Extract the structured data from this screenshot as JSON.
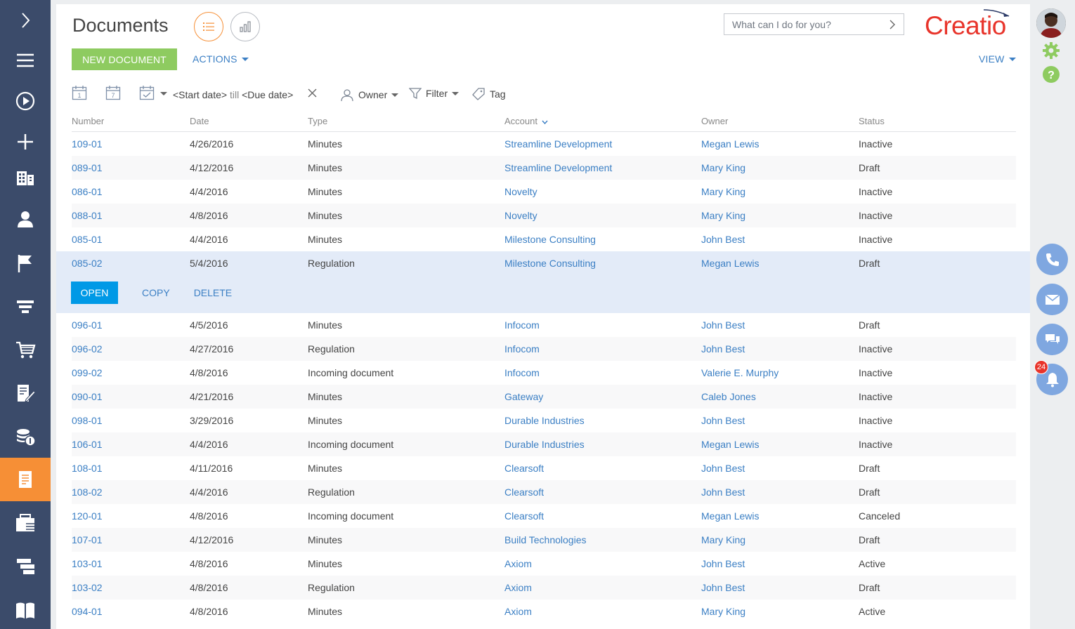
{
  "page": {
    "title": "Documents",
    "new_button": "NEW DOCUMENT",
    "actions_label": "ACTIONS",
    "view_label": "VIEW"
  },
  "search": {
    "placeholder": "What can I do for you?"
  },
  "logo": {
    "text": "Creatio"
  },
  "filters": {
    "calendar_day": "1",
    "calendar_week": "7",
    "start_date": "<Start date>",
    "till": "till",
    "due_date": "<Due date>",
    "owner_label": "Owner",
    "filter_label": "Filter",
    "tag_label": "Tag"
  },
  "columns": {
    "number": "Number",
    "date": "Date",
    "type": "Type",
    "account": "Account",
    "owner": "Owner",
    "status": "Status"
  },
  "row_actions": {
    "open": "OPEN",
    "copy": "COPY",
    "delete": "DELETE"
  },
  "rows": [
    {
      "number": "109-01",
      "date": "4/26/2016",
      "type": "Minutes",
      "account": "Streamline Development",
      "owner": "Megan Lewis",
      "status": "Inactive"
    },
    {
      "number": "089-01",
      "date": "4/12/2016",
      "type": "Minutes",
      "account": "Streamline Development",
      "owner": "Mary King",
      "status": "Draft"
    },
    {
      "number": "086-01",
      "date": "4/4/2016",
      "type": "Minutes",
      "account": "Novelty",
      "owner": "Mary King",
      "status": "Inactive"
    },
    {
      "number": "088-01",
      "date": "4/8/2016",
      "type": "Minutes",
      "account": "Novelty",
      "owner": "Mary King",
      "status": "Inactive"
    },
    {
      "number": "085-01",
      "date": "4/4/2016",
      "type": "Minutes",
      "account": "Milestone Consulting",
      "owner": "John Best",
      "status": "Inactive"
    },
    {
      "number": "085-02",
      "date": "5/4/2016",
      "type": "Regulation",
      "account": "Milestone Consulting",
      "owner": "Megan Lewis",
      "status": "Draft",
      "selected": true
    },
    {
      "number": "096-01",
      "date": "4/5/2016",
      "type": "Minutes",
      "account": "Infocom",
      "owner": "John Best",
      "status": "Draft"
    },
    {
      "number": "096-02",
      "date": "4/27/2016",
      "type": "Regulation",
      "account": "Infocom",
      "owner": "John Best",
      "status": "Inactive"
    },
    {
      "number": "099-02",
      "date": "4/8/2016",
      "type": "Incoming document",
      "account": "Infocom",
      "owner": "Valerie E. Murphy",
      "status": "Inactive"
    },
    {
      "number": "090-01",
      "date": "4/21/2016",
      "type": "Minutes",
      "account": "Gateway",
      "owner": "Caleb Jones",
      "status": "Inactive"
    },
    {
      "number": "098-01",
      "date": "3/29/2016",
      "type": "Minutes",
      "account": "Durable Industries",
      "owner": "John Best",
      "status": "Inactive"
    },
    {
      "number": "106-01",
      "date": "4/4/2016",
      "type": "Incoming document",
      "account": "Durable Industries",
      "owner": "Megan Lewis",
      "status": "Inactive"
    },
    {
      "number": "108-01",
      "date": "4/11/2016",
      "type": "Minutes",
      "account": "Clearsoft",
      "owner": "John Best",
      "status": "Draft"
    },
    {
      "number": "108-02",
      "date": "4/4/2016",
      "type": "Regulation",
      "account": "Clearsoft",
      "owner": "John Best",
      "status": "Draft"
    },
    {
      "number": "120-01",
      "date": "4/8/2016",
      "type": "Incoming document",
      "account": "Clearsoft",
      "owner": "Megan Lewis",
      "status": "Canceled"
    },
    {
      "number": "107-01",
      "date": "4/12/2016",
      "type": "Minutes",
      "account": "Build Technologies",
      "owner": "Mary King",
      "status": "Draft"
    },
    {
      "number": "103-01",
      "date": "4/8/2016",
      "type": "Minutes",
      "account": "Axiom",
      "owner": "John Best",
      "status": "Active"
    },
    {
      "number": "103-02",
      "date": "4/8/2016",
      "type": "Regulation",
      "account": "Axiom",
      "owner": "John Best",
      "status": "Draft"
    },
    {
      "number": "094-01",
      "date": "4/8/2016",
      "type": "Minutes",
      "account": "Axiom",
      "owner": "Mary King",
      "status": "Active"
    }
  ],
  "notifications": {
    "count": "24"
  },
  "icons": {
    "nav": [
      "chevron-right-icon",
      "menu-icon",
      "play-icon",
      "plus-icon",
      "building-icon",
      "person-icon",
      "flag-icon",
      "funnel-icon",
      "cart-icon",
      "contract-icon",
      "coins-icon",
      "document-icon",
      "briefcase-icon",
      "projects-icon",
      "book-icon"
    ],
    "right": [
      "gear-icon",
      "help-icon",
      "phone-icon",
      "mail-icon",
      "chat-icon",
      "bell-icon"
    ]
  },
  "colors": {
    "nav_bg": "#3b4b6a",
    "nav_active": "#f68f36",
    "link": "#3b7fc4",
    "primary_green": "#8ecb60",
    "open_blue": "#0099e6",
    "selected_row": "#e3ebf8",
    "brand_red": "#e8342b"
  }
}
